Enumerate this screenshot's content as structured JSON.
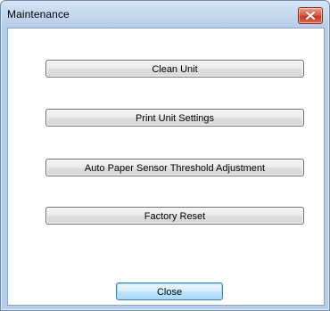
{
  "window": {
    "title": "Maintenance",
    "close_icon": "close-icon"
  },
  "buttons": {
    "clean_unit": "Clean Unit",
    "print_unit_settings": "Print Unit Settings",
    "auto_paper_sensor": "Auto Paper Sensor Threshold Adjustment",
    "factory_reset": "Factory Reset",
    "close": "Close"
  },
  "colors": {
    "title_bar": "#c6d9ef",
    "close_button": "#c63a22",
    "default_button_border": "#3c7fb1"
  }
}
